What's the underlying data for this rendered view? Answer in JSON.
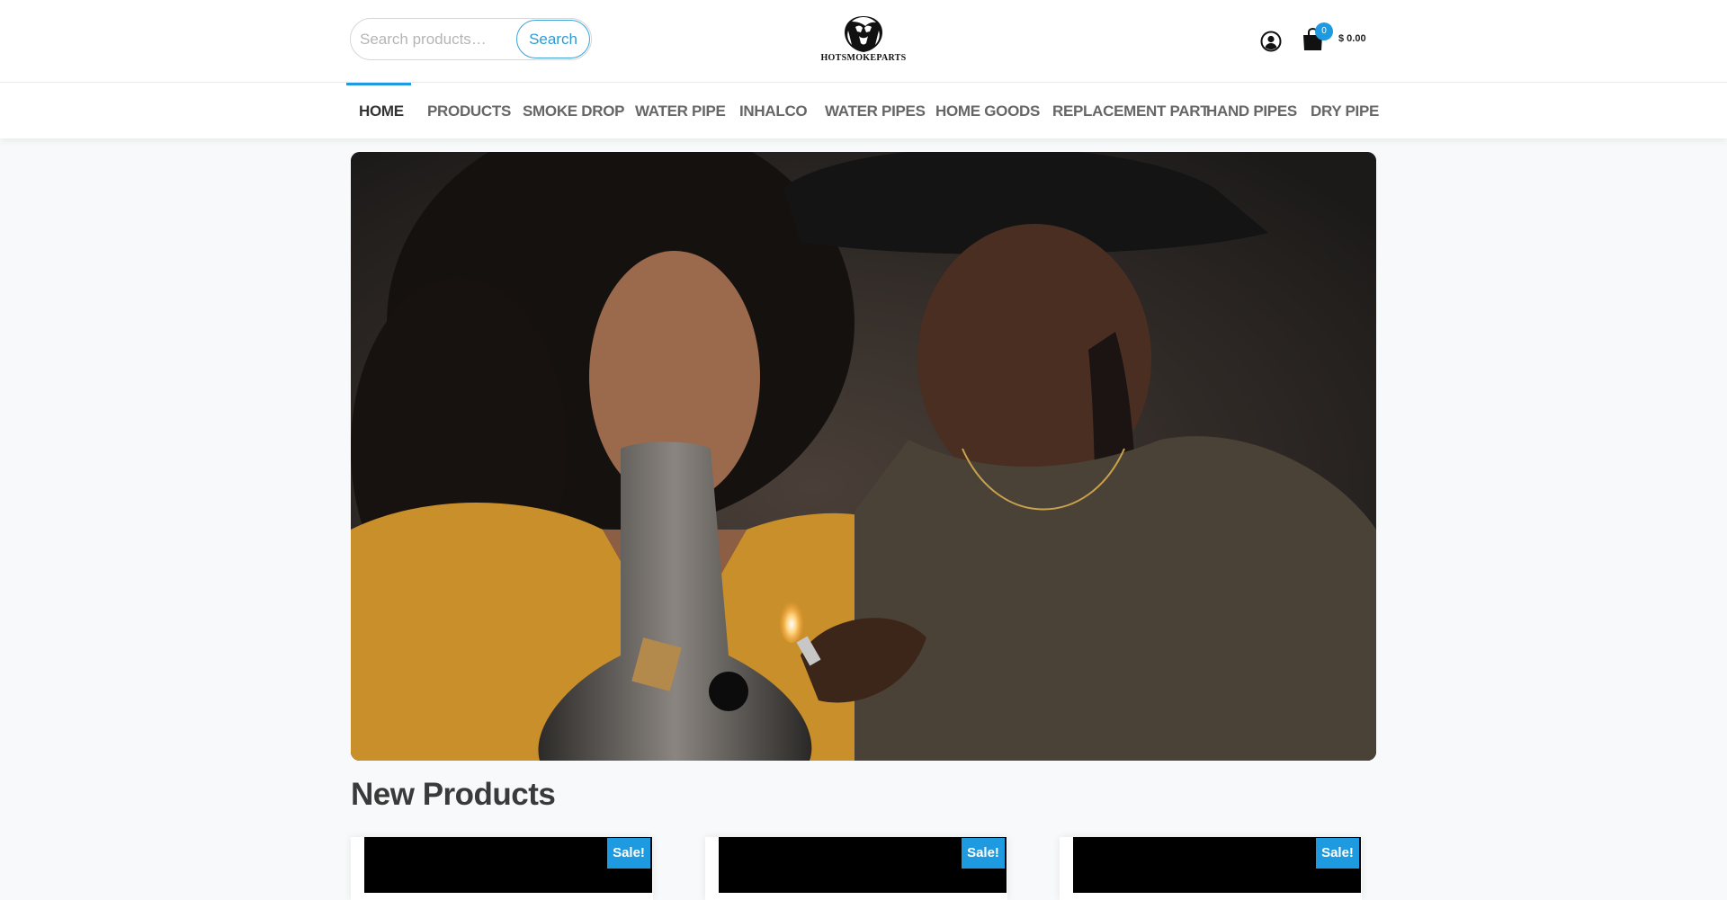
{
  "search": {
    "placeholder": "Search products…",
    "button_label": "Search"
  },
  "logo": {
    "text": "HOTSMOKEPARTS"
  },
  "cart": {
    "count": "0",
    "total": "$ 0.00"
  },
  "nav": {
    "items": [
      {
        "label": "HOME",
        "active": true
      },
      {
        "label": "PRODUCTS"
      },
      {
        "label": "SMOKE DROP"
      },
      {
        "label": "WATER PIPE"
      },
      {
        "label": "INHALCO"
      },
      {
        "label": "WATER PIPES"
      },
      {
        "label": "HOME GOODS"
      },
      {
        "label": "REPLACEMENT PART"
      },
      {
        "label": "HAND PIPES"
      },
      {
        "label": "DRY PIPE"
      }
    ]
  },
  "section": {
    "title": "New Products"
  },
  "products": [
    {
      "badge": "Sale!"
    },
    {
      "badge": "Sale!"
    },
    {
      "badge": "Sale!"
    }
  ],
  "colors": {
    "accent": "#1e9ae0",
    "text_dark": "#333333",
    "nav_text": "#666666"
  }
}
